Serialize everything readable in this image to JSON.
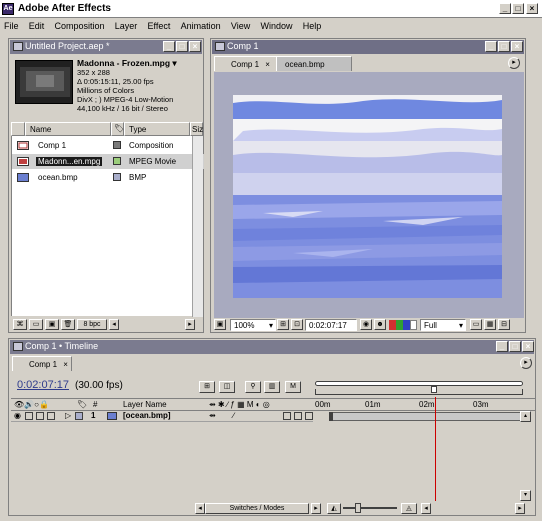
{
  "app": {
    "title": "Adobe After Effects"
  },
  "menubar": [
    "File",
    "Edit",
    "Composition",
    "Layer",
    "Effect",
    "Animation",
    "View",
    "Window",
    "Help"
  ],
  "project": {
    "title": "Untitled Project.aep *",
    "selected_name": "Madonna - Frozen.mpg ▾",
    "info": [
      "352 x 288",
      "Δ 0:05:15:11, 25.00 fps",
      "Millions of Colors",
      "DivX ; ) MPEG-4 Low-Motion",
      "44,100 kHz / 16 bit / Stereo"
    ],
    "columns": {
      "name": "Name",
      "type": "Type",
      "size": "Siz"
    },
    "items": [
      {
        "name": "Comp 1",
        "type": "Composition",
        "color": "#7a7a7a",
        "icon": "composition-icon"
      },
      {
        "name": "Madonn...en.mpg",
        "type": "MPEG Movie",
        "color": "#9acd7a",
        "icon": "movie-icon"
      },
      {
        "name": "ocean.bmp",
        "type": "BMP",
        "color": "#a9aecb",
        "icon": "image-icon"
      }
    ],
    "bpc": "8 bpc"
  },
  "comp": {
    "title": "Comp 1",
    "tabs": [
      "Comp 1",
      "ocean.bmp"
    ],
    "zoom": "100%",
    "timecode": "0:02:07:17",
    "resolution": "Full"
  },
  "timeline": {
    "title": "Comp 1 • Timeline",
    "tab": "Comp 1",
    "time": "0:02:07:17",
    "fps": "(30.00 fps)",
    "columns": {
      "hash": "#",
      "layer_name": "Layer Name"
    },
    "ruler": [
      "00m",
      "01m",
      "02m",
      "03m"
    ],
    "layers": [
      {
        "index": "1",
        "name": "[ocean.bmp]"
      }
    ],
    "switches_label": "Switches / Modes"
  },
  "colors": {
    "title_bar": "#7b7b8f",
    "timecode": "#2f3c8c",
    "playhead": "#cc0000"
  }
}
